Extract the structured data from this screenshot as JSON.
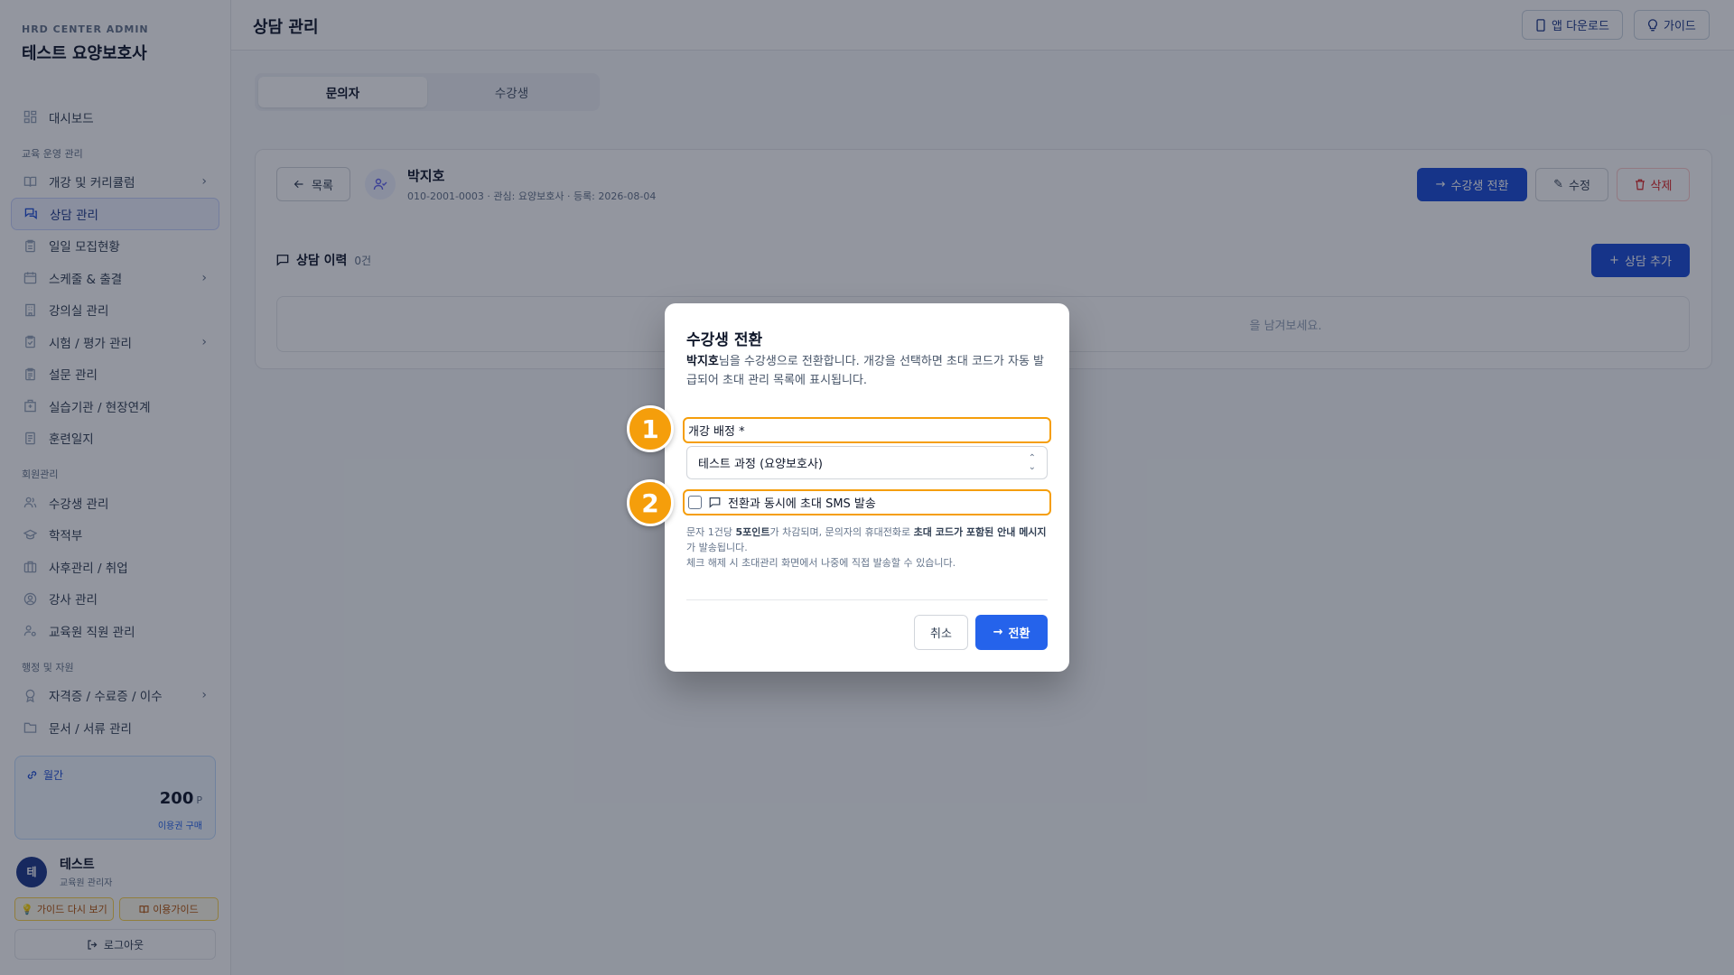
{
  "brand": {
    "sub": "HRD CENTER ADMIN",
    "title": "테스트 요양보호사"
  },
  "sidebar": {
    "dashboard": "대시보드",
    "section_ops": "교육 운영 관리",
    "ops_items": [
      "개강 및 커리큘럼",
      "상담 관리",
      "일일 모집현황",
      "스케줄 & 출결",
      "강의실 관리",
      "시험 / 평가 관리",
      "설문 관리",
      "실습기관 / 현장연계",
      "훈련일지"
    ],
    "section_members": "회원관리",
    "member_items": [
      "수강생 관리",
      "학적부",
      "사후관리 / 취업",
      "강사 관리",
      "교육원 직원 관리"
    ],
    "section_admin": "행정 및 자원",
    "admin_items": [
      "자격증 / 수료증 / 이수",
      "문서 / 서류 관리"
    ]
  },
  "points": {
    "label": "월간",
    "value": "200",
    "unit": "P",
    "buy": "이용권 구매"
  },
  "user": {
    "initial": "테",
    "name": "테스트",
    "role": "교육원 관리자"
  },
  "footer": {
    "guide_again": "가이드 다시 보기",
    "usage_guide": "이용가이드",
    "logout": "로그아웃"
  },
  "header": {
    "title": "상담 관리",
    "app_download": "앱 다운로드",
    "guide": "가이드"
  },
  "tabs": [
    "문의자",
    "수강생"
  ],
  "profile": {
    "back": "목록",
    "name": "박지호",
    "meta": "010-2001-0003 · 관심: 요양보호사 · 등록: 2026-08-04"
  },
  "actions": {
    "convert": "수강생 전환",
    "edit": "수정",
    "delete": "삭제"
  },
  "history": {
    "title": "상담 이력",
    "count": "0건",
    "add": "상담 추가",
    "empty": "을 남겨보세요."
  },
  "modal": {
    "title": "수강생 전환",
    "desc_name": "박지호",
    "desc_rest": "님을 수강생으로 전환합니다. 개강을 선택하면 초대 코드가 자동 발급되어 초대 관리 목록에 표시됩니다.",
    "field_label": "개강 배정 *",
    "select_value": "테스트 과정 (요양보호사)",
    "sms_label": "전환과 동시에 초대 SMS 발송",
    "note1_a": "문자 1건당 ",
    "note1_b": "5포인트",
    "note1_c": "가 차감되며, 문의자의 휴대전화로 ",
    "note1_d": "초대 코드가 포함된 안내 메시지",
    "note1_e": "가 발송됩니다.",
    "note2": "체크 해제 시 초대관리 화면에서 나중에 직접 발송할 수 있습니다.",
    "cancel": "취소",
    "confirm": "전환"
  },
  "markers": [
    "1",
    "2"
  ],
  "colors": {
    "primary": "#1d4ed8",
    "highlight": "#f59e0b",
    "danger": "#dc2626"
  }
}
